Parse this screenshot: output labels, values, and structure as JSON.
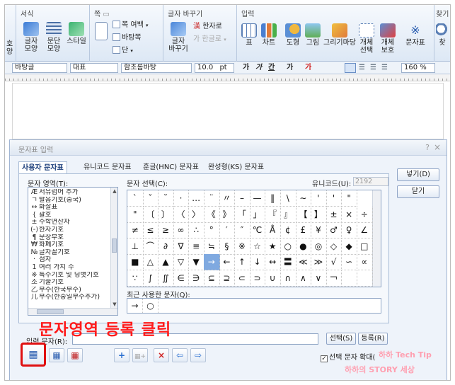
{
  "ribbon": {
    "groups": {
      "left_partial": {
        "items": [
          "호",
          "양"
        ]
      },
      "style": {
        "title": "서식",
        "buttons": [
          "글자\n모양",
          "문단\n모양",
          "스타일"
        ]
      },
      "page": {
        "title": "쪽",
        "buttons": [
          "쪽 여백",
          "바탕쪽",
          "단"
        ],
        "large": ""
      },
      "replace": {
        "title": "글자 바꾸기",
        "buttons": [
          "글자\n바꾸기",
          "한자로",
          "한글로"
        ]
      },
      "insert": {
        "title": "입력",
        "buttons": [
          "표",
          "차트",
          "도형",
          "그림",
          "그리기마당",
          "개체\n선택",
          "개체\n보호",
          "문자표"
        ]
      },
      "find": {
        "title": "찾기",
        "items": [
          "찾"
        ]
      }
    }
  },
  "format_bar": {
    "style": "바탕글",
    "lang": "대표",
    "font": "함초롬바탕",
    "size": "10.0",
    "unit": "pt",
    "bold": "가",
    "italic": "가",
    "underline": "간",
    "strike": "가",
    "color": "가",
    "zoom": "160",
    "zoom_unit": "%"
  },
  "dialog": {
    "title": "문자표 입력",
    "help_icon": "?",
    "close_icon": "×",
    "tabs": [
      "사용자 문자표",
      "유니코드 문자표",
      "훈글(HNC) 문자표",
      "완성형(KS) 문자표"
    ],
    "area_label": "문자 영역(T):",
    "areas": [
      [
        "Æ",
        "서유럽어 추가"
      ],
      [
        "ㄱ",
        "발음기호(중국)"
      ],
      [
        "↔",
        "화살표"
      ],
      [
        "{",
        "괄호"
      ],
      [
        "±",
        "수학연산자"
      ],
      [
        "(-)",
        "한자기호"
      ],
      [
        "¶",
        "문장부호"
      ],
      [
        "₩",
        "화폐기호"
      ],
      [
        "№",
        "글자꼴기호"
      ],
      [
        "·",
        "점자"
      ],
      [
        "1",
        "여러 가지 수"
      ],
      [
        "※",
        "특수기호 및 딩뱃기호"
      ],
      [
        "조",
        "기술기호"
      ],
      [
        "乙",
        "부수(한국부수)"
      ],
      [
        "几",
        "부수(한중일부수추가)"
      ]
    ],
    "select_label": "문자 선택(C):",
    "unicode_label": "유니코드(U):",
    "unicode_value": "2192",
    "grid": [
      [
        "`",
        "ˇ",
        "˘",
        "·",
        "…",
        "¨",
        "〃",
        "–",
        "—",
        "‖",
        "\\",
        "∼",
        "'",
        "'",
        "\""
      ],
      [
        "\"",
        "〔",
        "〕",
        "〈",
        "〉",
        "《",
        "》",
        "「",
        "」",
        "『",
        "』",
        "【",
        "】",
        "±",
        "×",
        "÷"
      ],
      [
        "≠",
        "≤",
        "≥",
        "∞",
        "∴",
        "°",
        "′",
        "″",
        "℃",
        "Å",
        "¢",
        "£",
        "¥",
        "♂",
        "♀",
        "∠"
      ],
      [
        "⊥",
        "⌒",
        "∂",
        "∇",
        "≡",
        "≒",
        "§",
        "※",
        "☆",
        "★",
        "○",
        "●",
        "◎",
        "◇",
        "◆",
        "□"
      ],
      [
        "■",
        "△",
        "▲",
        "▽",
        "▼",
        "→",
        "←",
        "↑",
        "↓",
        "↔",
        "〓",
        "≪",
        "≫",
        "√",
        "∽",
        "∝"
      ],
      [
        "∵",
        "∫",
        "∬",
        "∈",
        "∋",
        "⊆",
        "⊇",
        "⊂",
        "⊃",
        "∪",
        "∩",
        "∧",
        "∨",
        "￢",
        "",
        ""
      ]
    ],
    "selected_char": "→",
    "recent_label": "최근 사용한 문자(Q):",
    "recent": [
      "→",
      "○"
    ],
    "insert_btn": "넣기(D)",
    "close_btn": "닫기",
    "input_label": "입력 문자(R):",
    "input_value": "",
    "select_btn": "선택(S)",
    "register_btn": "등록(R)",
    "toolbar_icons": [
      "+",
      "▦+",
      "×",
      "⇦",
      "⇨"
    ],
    "enlarge_label": "선택 문자 확대(",
    "enlarge_checked": "✓"
  },
  "annotation": {
    "caption": "문자영역 등록 클릭",
    "watermark1": "하하 Tech Tip",
    "watermark2": "하하의 STORY 세상"
  }
}
